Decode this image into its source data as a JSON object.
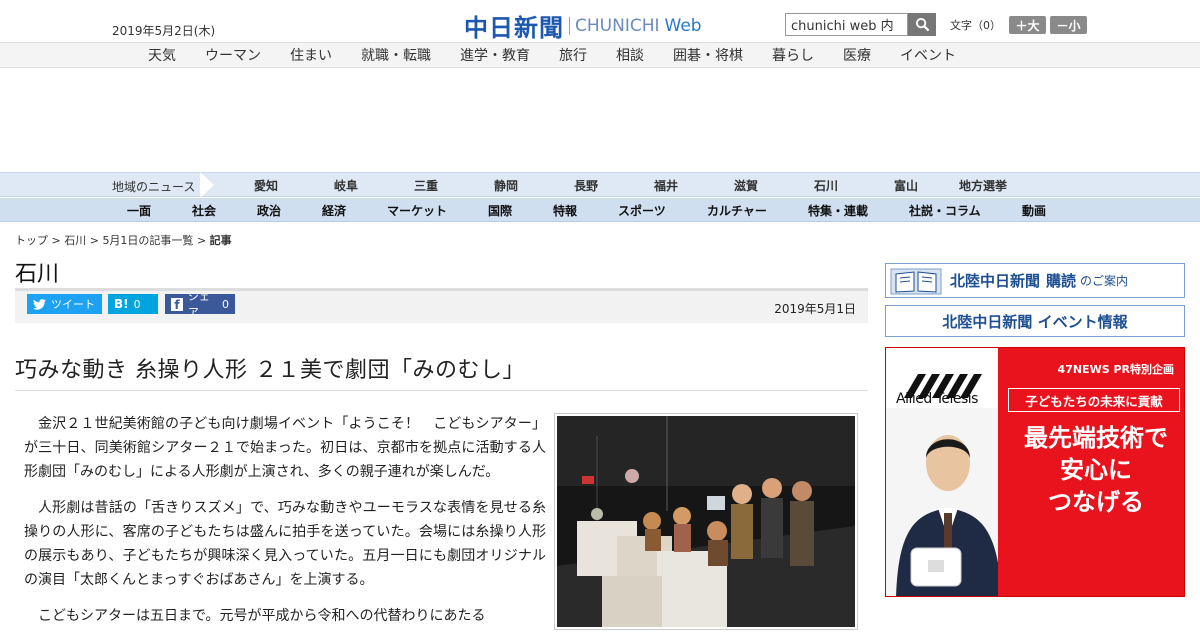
{
  "header": {
    "date": "2019年5月2日(木)",
    "logo_ja": "中日新聞",
    "logo_en": "CHUNICHI",
    "logo_web": "Web",
    "search_value": "chunichi web 内",
    "font_label": "文字（0）",
    "font_plus": "＋大",
    "font_minus": "－小"
  },
  "genre_nav": [
    "天気",
    "ウーマン",
    "住まい",
    "就職・転職",
    "進学・教育",
    "旅行",
    "相談",
    "囲碁・将棋",
    "暮らし",
    "医療",
    "イベント"
  ],
  "region_nav": {
    "label": "地域のニュース",
    "items": [
      "愛知",
      "岐阜",
      "三重",
      "静岡",
      "長野",
      "福井",
      "滋賀",
      "石川",
      "富山",
      "地方選挙"
    ]
  },
  "category_nav": [
    "一面",
    "社会",
    "政治",
    "経済",
    "マーケット",
    "国際",
    "特報",
    "スポーツ",
    "カルチャー",
    "特集・連載",
    "社説・コラム",
    "動画"
  ],
  "breadcrumb": {
    "top": "トップ",
    "region": "石川",
    "list": "5月1日の記事一覧",
    "current": "記事"
  },
  "section_title": "石川",
  "share": {
    "tweet": "ツイート",
    "hatena_icon": "B!",
    "hatena_count": "0",
    "facebook_icon": "f",
    "facebook_label": "シェア",
    "facebook_count": "0",
    "published": "2019年5月1日"
  },
  "article": {
    "headline": "巧みな動き 糸操り人形 ２１美で劇団「みのむし」",
    "paragraphs": [
      "金沢２１世紀美術館の子ども向け劇場イベント「ようこそ！　こどもシアター」が三十日、同美術館シアター２１で始まった。初日は、京都市を拠点に活動する人形劇団「みのむし」による人形劇が上演され、多くの親子連れが楽しんだ。",
      "人形劇は昔話の「舌きりスズメ」で、巧みな動きやユーモラスな表情を見せる糸操りの人形に、客席の子どもたちは盛んに拍手を送っていた。会場には糸操り人形の展示もあり、子どもたちが興味深く見入っていた。五月一日にも劇団オリジナルの演目「太郎くんとまっすぐおばあさん」を上演する。",
      "こどもシアターは五日まで。元号が平成から令和への代替わりにあたる"
    ]
  },
  "sidebar": {
    "subscribe_title": "北陸中日新聞",
    "subscribe_bold": "購読",
    "subscribe_suffix": "のご案内",
    "event_title": "北陸中日新聞 イベント情報",
    "ad": {
      "top_label": "47NEWS PR特別企画",
      "subtitle": "子どもたちの未来に貢献",
      "main_lines": [
        "最先端技術で",
        "安心に",
        "つなげる"
      ],
      "brand": "Allied Telesis",
      "accent_color": "#e8131c"
    }
  }
}
